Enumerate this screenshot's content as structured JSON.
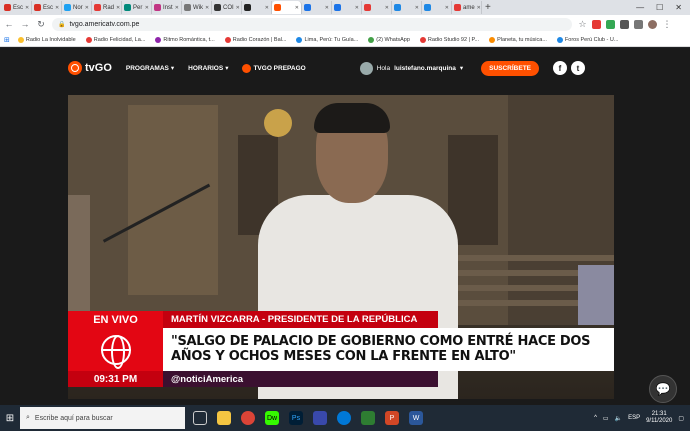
{
  "browser": {
    "tabs": [
      {
        "label": "Esc",
        "color": "#d93025"
      },
      {
        "label": "Esc",
        "color": "#d93025"
      },
      {
        "label": "Nor",
        "color": "#1da1f2"
      },
      {
        "label": "Rad",
        "color": "#e53935"
      },
      {
        "label": "Per",
        "color": "#00897b"
      },
      {
        "label": "Inst",
        "color": "#c13584"
      },
      {
        "label": "Wik",
        "color": "#777777"
      },
      {
        "label": "COI",
        "color": "#333333"
      },
      {
        "label": "",
        "color": "#222222"
      },
      {
        "label": "",
        "color": "#ff5000"
      },
      {
        "label": "",
        "color": "#1a73e8"
      },
      {
        "label": "",
        "color": "#1a73e8"
      },
      {
        "label": "",
        "color": "#e53935"
      },
      {
        "label": "",
        "color": "#1e88e5"
      },
      {
        "label": "",
        "color": "#1e88e5"
      },
      {
        "label": "ame",
        "color": "#e53935"
      }
    ],
    "url": "tvgo.americatv.com.pe",
    "bookmarks": [
      {
        "label": "Radio La Inolvidable",
        "color": "#fbc02d"
      },
      {
        "label": "Radio Felicidad, La...",
        "color": "#e53935"
      },
      {
        "label": "Ritmo Romántica, t...",
        "color": "#8e24aa"
      },
      {
        "label": "Radio Corazón | Bal...",
        "color": "#e53935"
      },
      {
        "label": "Lima, Perú: Tu Guía...",
        "color": "#1e88e5"
      },
      {
        "label": "(2) WhatsApp",
        "color": "#43a047"
      },
      {
        "label": "Radio Studio 92 | P...",
        "color": "#e53935"
      },
      {
        "label": "Planeta, tu música...",
        "color": "#fb8c00"
      },
      {
        "label": "Foros Perú Club - U...",
        "color": "#1e88e5"
      }
    ]
  },
  "site": {
    "logo": "tvGO",
    "menu": [
      "PROGRAMAS",
      "HORARIOS",
      "TVGO PREPAGO"
    ],
    "greeting": "Hola",
    "username": "luistefano.marquina",
    "subscribe": "SUSCRÍBETE"
  },
  "broadcast": {
    "live_label": "EN VIVO",
    "speaker": "MARTÍN VIZCARRA - PRESIDENTE DE LA REPÚBLICA",
    "headline": "\"SALGO DE PALACIO DE GOBIERNO COMO ENTRÉ HACE DOS AÑOS Y OCHOS MESES CON LA FRENTE EN ALTO\"",
    "time": "09:31 PM",
    "handle": "@noticiAmerica"
  },
  "taskbar": {
    "search_placeholder": "Escribe aquí para buscar",
    "language": "ESP",
    "clock_time": "21:31",
    "clock_date": "9/11/2020"
  }
}
